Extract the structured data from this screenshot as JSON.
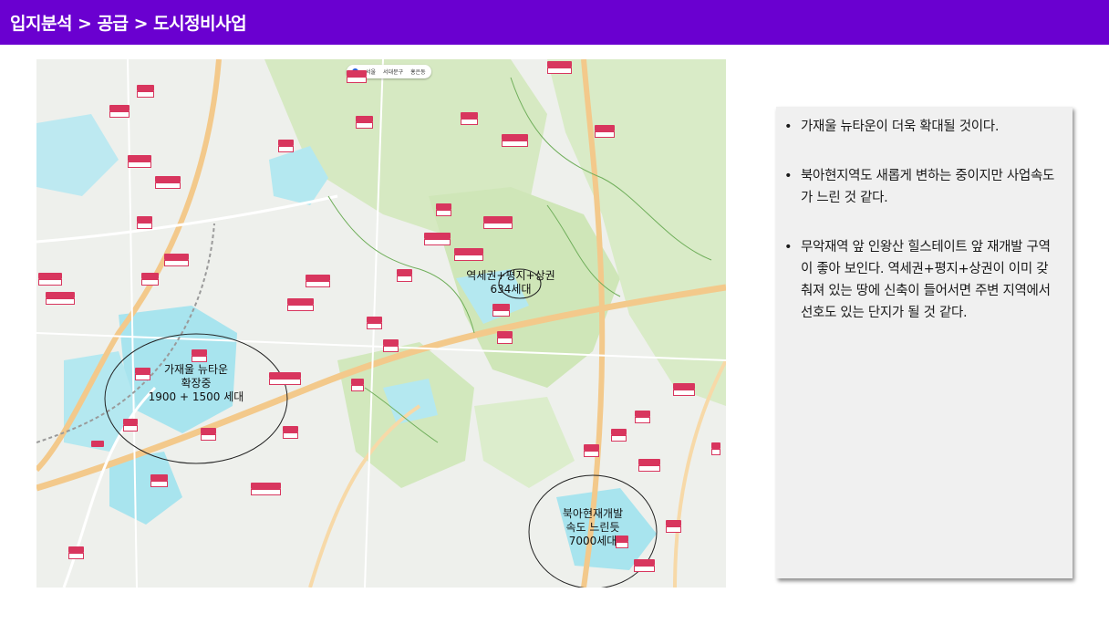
{
  "header": {
    "breadcrumb": "입지분석 > 공급 > 도시정비사업"
  },
  "map": {
    "chips": [
      "서울",
      "서대문구",
      "홍은동"
    ],
    "annotations": [
      {
        "lines": [
          "가재울 뉴타운",
          "확장중",
          "1900 + 1500 세대"
        ]
      },
      {
        "lines": [
          "역세권+평지+상권",
          "634세대"
        ]
      },
      {
        "lines": [
          "북아현재개발",
          "속도 느린듯",
          "7000세대"
        ]
      }
    ]
  },
  "panel": {
    "bullets": [
      "가재울 뉴타운이 더욱 확대될 것이다.",
      "북아현지역도 새롭게 변하는 중이지만 사업속도가 느린 것 같다.",
      "무악재역 앞 인왕산 힐스테이트 앞 재개발 구역이 좋아 보인다. 역세권+평지+상권이 이미 갖춰져 있는 땅에 신축이 들어서면 주변 지역에서 선호도 있는 단지가 될 것 같다."
    ]
  },
  "colors": {
    "header_bg": "#6a00d0",
    "tag_red": "#d8365e",
    "redev_zone": "#a8e4ee",
    "park_green": "#cfe6b8"
  }
}
